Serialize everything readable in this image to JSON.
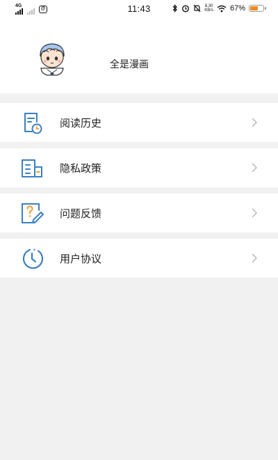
{
  "status_bar": {
    "network": "4G",
    "time": "11:43",
    "speed_top": "8.30",
    "speed_bottom": "KB/s",
    "battery_percent": "67%",
    "battery_level": 0.67
  },
  "profile": {
    "nickname": "全是漫画"
  },
  "menu": [
    {
      "label": "阅读历史",
      "icon": "reading-history-icon"
    },
    {
      "label": "隐私政策",
      "icon": "privacy-policy-icon"
    },
    {
      "label": "问题反馈",
      "icon": "feedback-icon"
    },
    {
      "label": "用户协议",
      "icon": "user-agreement-icon"
    }
  ],
  "colors": {
    "icon_blue": "#3a7fc1",
    "icon_orange": "#f0a030",
    "background": "#f1f1f1"
  }
}
